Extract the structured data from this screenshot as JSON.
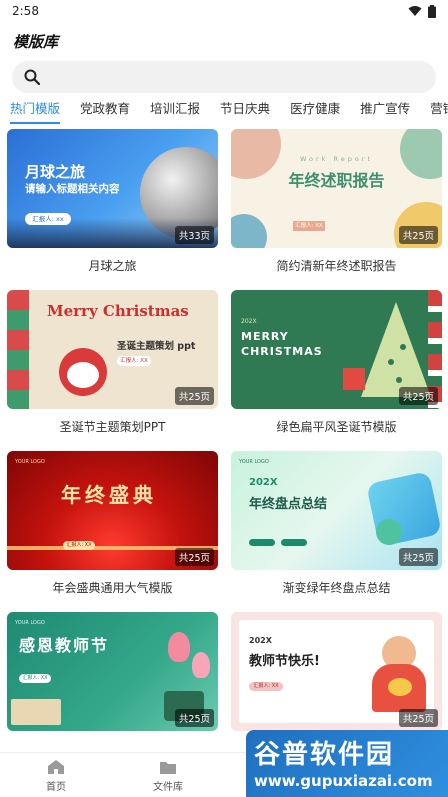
{
  "status": {
    "time": "2:58"
  },
  "header": {
    "title": "模版库"
  },
  "search": {
    "placeholder": ""
  },
  "tabs": [
    "热门模版",
    "党政教育",
    "培训汇报",
    "节日庆典",
    "医疗健康",
    "推广宣传",
    "营销策划"
  ],
  "active_tab": 0,
  "cards": [
    {
      "title": "月球之旅",
      "pages": "共33页",
      "t1": "月球之旅",
      "t2": "请输入标题相关内容",
      "t3": "汇报人: xx"
    },
    {
      "title": "简约清新年终述职报告",
      "pages": "共25页",
      "t1": "年终述职报告",
      "t2": "Work Report",
      "t3": "汇报人: XX"
    },
    {
      "title": "圣诞节主题策划PPT",
      "pages": "共25页",
      "t1": "Merry Christmas",
      "t2": "圣诞主题策划 ppt",
      "t3": "汇报人: XX"
    },
    {
      "title": "绿色扁平风圣诞节模版",
      "pages": "共25页",
      "t1": "MERRY",
      "t2": "CHRISTMAS",
      "t3": "202X"
    },
    {
      "title": "年会盛典通用大气模版",
      "pages": "共25页",
      "t1": "年终盛典",
      "t2": "YOUR LOGO",
      "t3": "汇报人: XX"
    },
    {
      "title": "渐变绿年终盘点总结",
      "pages": "共25页",
      "t1": "年终盘点总结",
      "t2": "202X",
      "t3": "YOUR LOGO"
    },
    {
      "title": "感恩教师节",
      "pages": "共25页",
      "t1": "感恩教师节",
      "t2": "YOUR LOGO",
      "t3": "汇报人: XX"
    },
    {
      "title": "教师节快乐",
      "pages": "共25页",
      "t1": "教师节快乐!",
      "t2": "202X",
      "t3": "汇报人: XX"
    }
  ],
  "bottom_nav": {
    "home": "首页",
    "files": "文件库"
  },
  "watermark": {
    "main": "谷普软件园",
    "sub": "www.gupuxiazai.com"
  }
}
